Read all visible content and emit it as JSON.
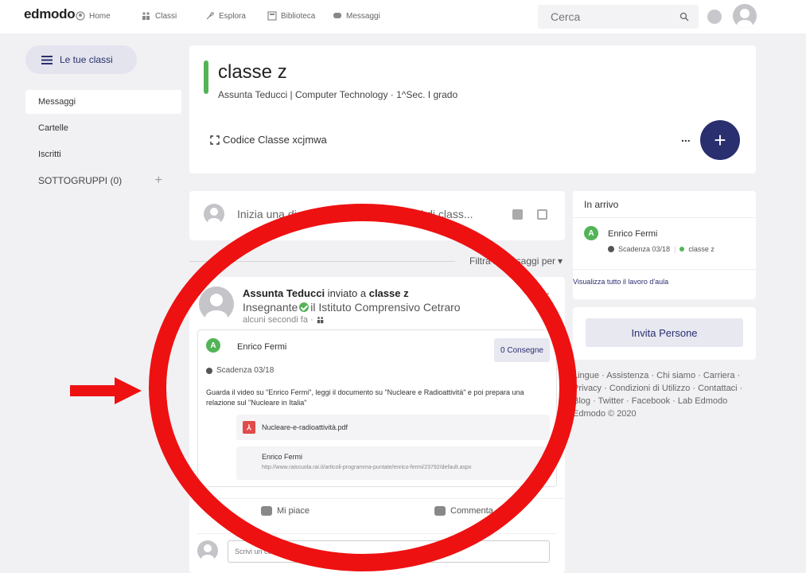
{
  "nav": {
    "logo": "edmodo",
    "items": [
      "Home",
      "Classi",
      "Esplora",
      "Biblioteca",
      "Messaggi"
    ],
    "search_placeholder": "Cerca"
  },
  "sidebar": {
    "classes_button": "Le tue classi",
    "items": [
      "Messaggi",
      "Cartelle",
      "Iscritti"
    ],
    "subgroups": "SOTTOGRUPPI (0)"
  },
  "class": {
    "name": "classe z",
    "subtitle": "Assunta Teducci | Computer Technology  · 1^Sec. I grado",
    "code_label": "Codice Classe xcjmwa",
    "more": "...",
    "add": "+"
  },
  "composer": {
    "placeholder": "Inizia una discussione con gli studenti di class..."
  },
  "filter": {
    "label": "Filtra i messaggi per"
  },
  "post": {
    "author": "Assunta Teducci",
    "action": " inviato a ",
    "target": "classe z",
    "role": "Insegnante",
    "school": "il Istituto Comprensivo Cetraro",
    "time": "alcuni secondi fa ·",
    "more": "···",
    "assignment": {
      "title": "Enrico Fermi",
      "button": "0 Consegne",
      "due": "Scadenza 03/18",
      "description": "Guarda il video su \"Enrico Fermi\", leggi il documento su \"Nucleare e Radioattività\" e poi prepara una relazione sul \"Nucleare in Italia\"",
      "pdf": "Nucleare-e-radioattività.pdf",
      "link_title": "Enrico Fermi",
      "link_url": "http://www.raiscuola.rai.it/articoli-programma-puntate/enrico-fermi/23792/default.aspx"
    },
    "like": "Mi piace",
    "comment": "Commenta",
    "comment_placeholder": "Scrivi un commento..."
  },
  "incoming": {
    "header": "In arrivo",
    "item_name": "Enrico Fermi",
    "item_due": "Scadenza 03/18",
    "item_class": "classe z",
    "view_all": "Visualizza tutto il lavoro d'aula"
  },
  "invite": {
    "button": "Invita Persone"
  },
  "footer": {
    "text": "Lingue · Assistenza · Chi siamo · Carriera · Privacy · Condizioni di Utilizzo · Contattaci · Blog · Twitter · Facebook · Lab Edmodo Edmodo © 2020"
  },
  "colors": {
    "accent": "#2a2f6f",
    "green": "#53b457",
    "annotation_red": "#ee1111"
  }
}
